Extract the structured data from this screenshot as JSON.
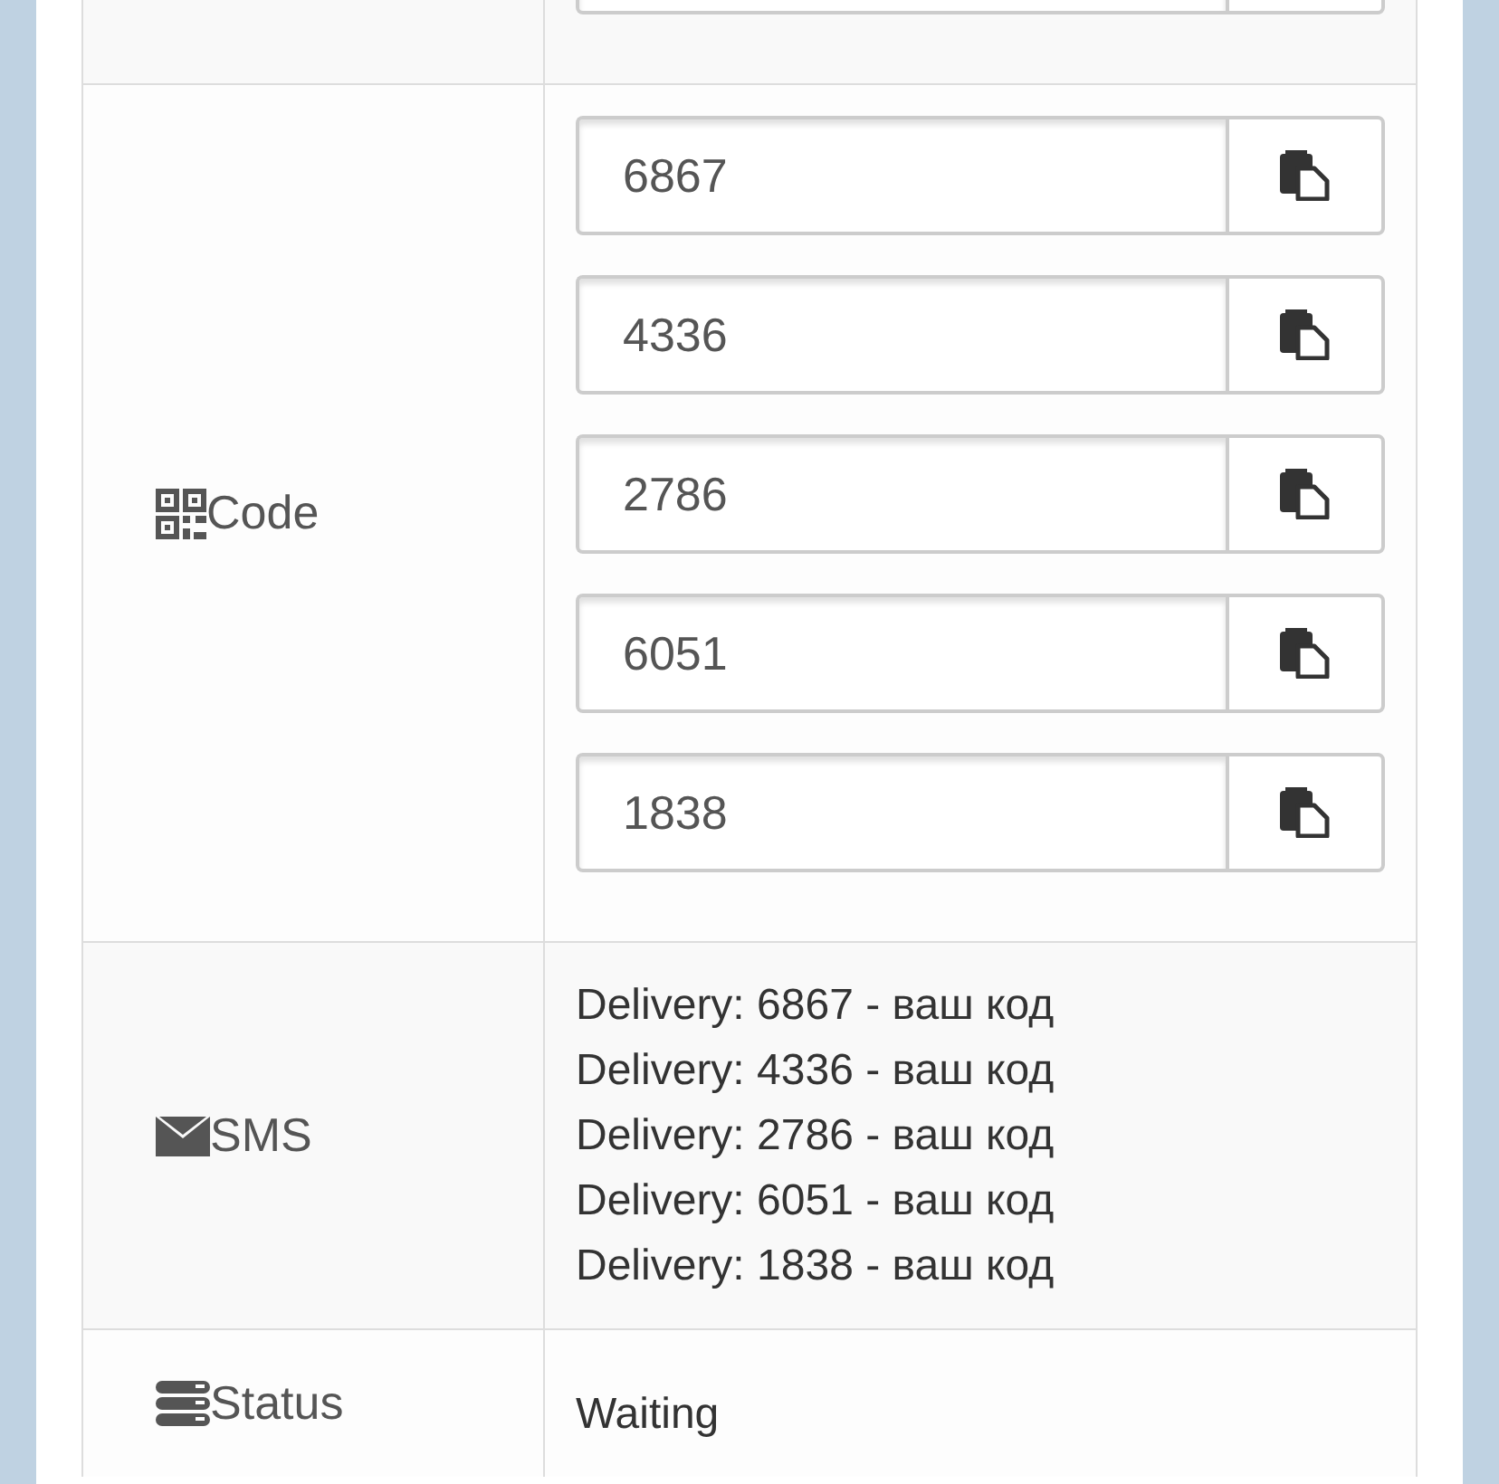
{
  "rows": [
    {
      "kind": "cut"
    },
    {
      "kind": "fields",
      "label": "Code",
      "values": [
        "6867",
        "4336",
        "2786",
        "6051",
        "1838"
      ]
    },
    {
      "kind": "lines",
      "label": "SMS",
      "lines": [
        "Delivery: 6867 - ваш код",
        "Delivery: 4336 - ваш код",
        "Delivery: 2786 - ваш код",
        "Delivery: 6051 - ваш код",
        "Delivery: 1838 - ваш код"
      ]
    },
    {
      "kind": "text",
      "label": "Status",
      "text": "Waiting"
    }
  ]
}
